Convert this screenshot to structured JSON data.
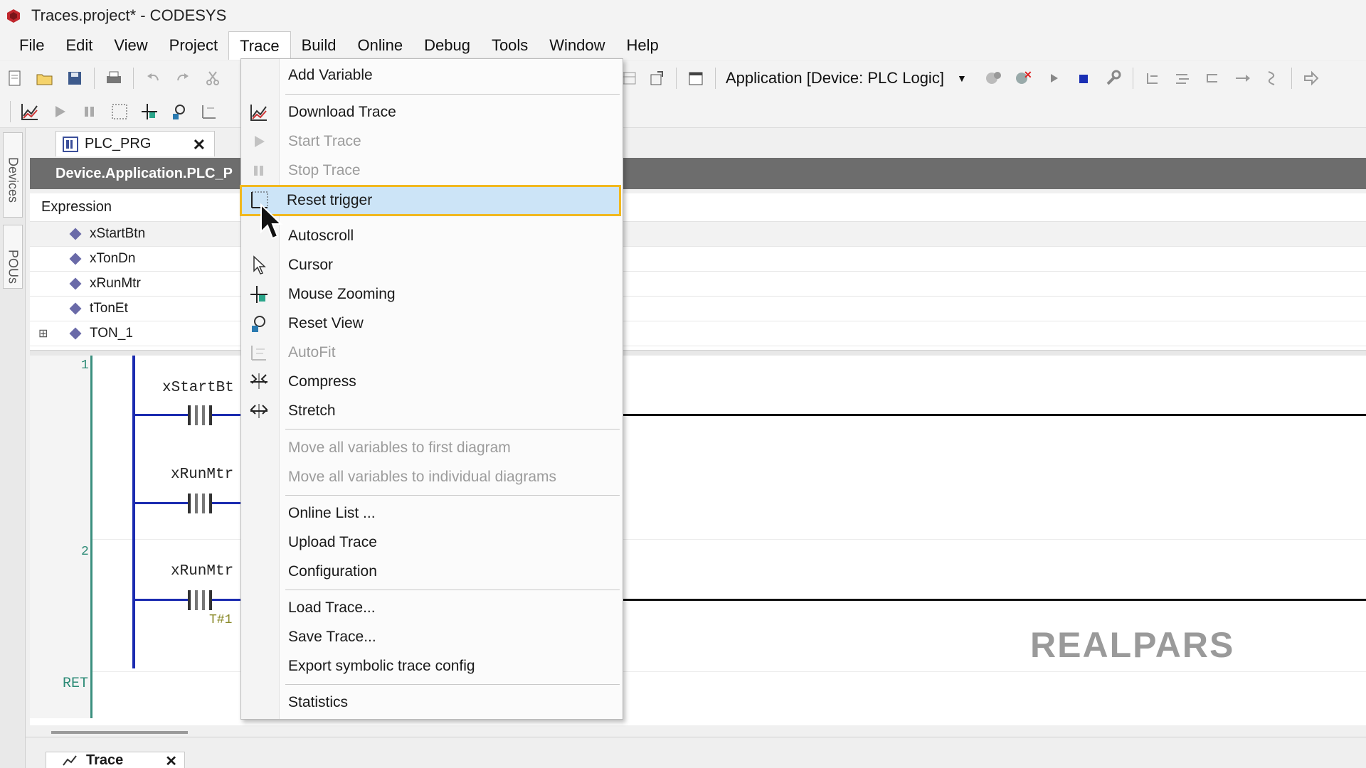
{
  "window": {
    "title": "Traces.project* - CODESYS"
  },
  "menubar": {
    "items": [
      "File",
      "Edit",
      "View",
      "Project",
      "Trace",
      "Build",
      "Online",
      "Debug",
      "Tools",
      "Window",
      "Help"
    ],
    "active": "Trace"
  },
  "toolbar": {
    "application_combo": "Application [Device: PLC Logic]"
  },
  "side_panels": {
    "devices": "Devices",
    "pous": "POUs"
  },
  "editor": {
    "tab_label": "PLC_PRG",
    "path": "Device.Application.PLC_P",
    "expression_header": "Expression",
    "variables": [
      "xStartBtn",
      "xTonDn",
      "xRunMtr",
      "tTonEt",
      "TON_1"
    ]
  },
  "ladder": {
    "network_numbers": [
      "1",
      "2"
    ],
    "return_label": "RET",
    "contacts": [
      "xStartBt",
      "xRunMtr",
      "xRunMtr"
    ],
    "timer_text": "T#1"
  },
  "watermark": "REALPARS",
  "bottom_tab": {
    "label": "Trace"
  },
  "trace_menu": {
    "items": [
      {
        "label": "Add Variable",
        "enabled": true,
        "icon": "none"
      },
      {
        "label": "Download Trace",
        "enabled": true,
        "icon": "chart-icon"
      },
      {
        "label": "Start Trace",
        "enabled": false,
        "icon": "play-icon"
      },
      {
        "label": "Stop Trace",
        "enabled": false,
        "icon": "pause-icon"
      },
      {
        "label": "Reset trigger",
        "enabled": true,
        "icon": "grid-icon",
        "highlighted": true
      },
      {
        "label": "Autoscroll",
        "enabled": true,
        "icon": "none"
      },
      {
        "label": "Cursor",
        "enabled": true,
        "icon": "pointer-icon"
      },
      {
        "label": "Mouse Zooming",
        "enabled": true,
        "icon": "crosshair-icon"
      },
      {
        "label": "Reset View",
        "enabled": true,
        "icon": "reset-view-icon"
      },
      {
        "label": "AutoFit",
        "enabled": false,
        "icon": "autofit-icon"
      },
      {
        "label": "Compress",
        "enabled": true,
        "icon": "compress-icon"
      },
      {
        "label": "Stretch",
        "enabled": true,
        "icon": "stretch-icon"
      },
      {
        "label": "Move all variables to first diagram",
        "enabled": false,
        "icon": "none"
      },
      {
        "label": "Move all variables to individual diagrams",
        "enabled": false,
        "icon": "none"
      },
      {
        "label": "Online List ...",
        "enabled": true,
        "icon": "none"
      },
      {
        "label": "Upload Trace",
        "enabled": true,
        "icon": "none"
      },
      {
        "label": "Configuration",
        "enabled": true,
        "icon": "none"
      },
      {
        "label": "Load Trace...",
        "enabled": true,
        "icon": "none"
      },
      {
        "label": "Save Trace...",
        "enabled": true,
        "icon": "none"
      },
      {
        "label": "Export symbolic trace config",
        "enabled": true,
        "icon": "none"
      },
      {
        "label": "Statistics",
        "enabled": true,
        "icon": "none"
      }
    ]
  },
  "colors": {
    "highlight_bg": "#cce4f7",
    "highlight_border": "#f1b81f",
    "rail": "#1b2bb0",
    "line_numbers": "#2c8a76"
  }
}
